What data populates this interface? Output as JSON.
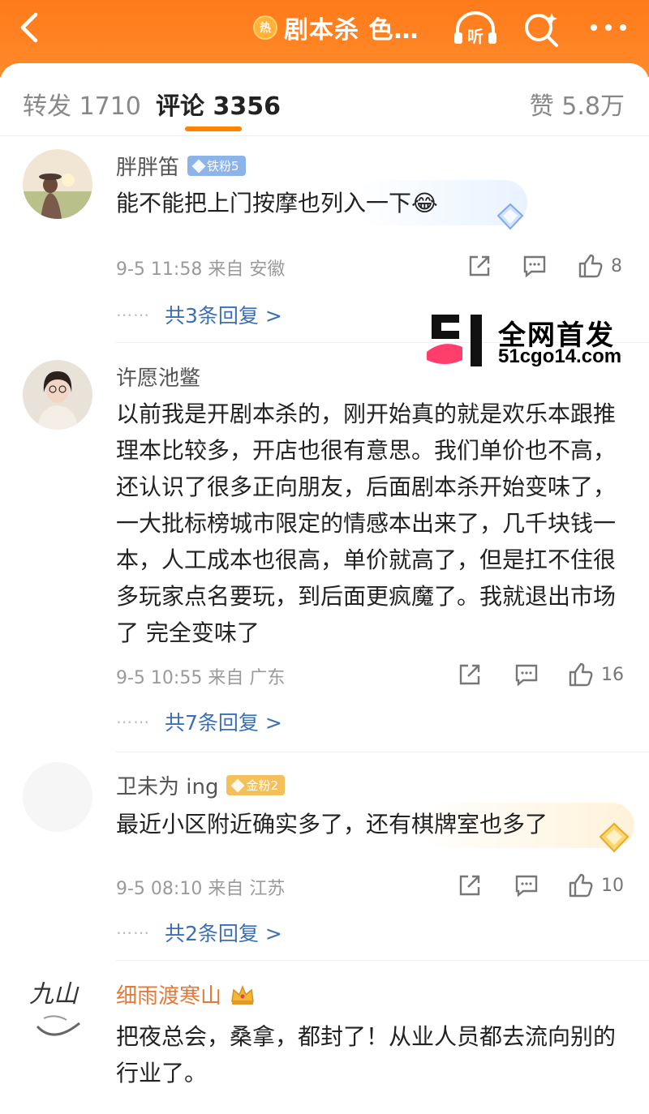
{
  "header": {
    "title": "剧本杀 色…",
    "hot_label": "热",
    "listen_label": "听"
  },
  "tabs": {
    "repost": "转发 1710",
    "comment": "评论 3356",
    "like": "赞 5.8万"
  },
  "watermark": {
    "line1": "全网首发",
    "line2": "51cgo14.com"
  },
  "comments": [
    {
      "username": "胖胖笛",
      "badge": "铁粉5",
      "text": "能不能把上门按摩也列入一下😂",
      "meta": "9-5 11:58 来自 安徽",
      "likes": "8",
      "replies": "共3条回复 >"
    },
    {
      "username": "许愿池鳖",
      "text": "以前我是开剧本杀的，刚开始真的就是欢乐本跟推理本比较多，开店也很有意思。我们单价也不高，还认识了很多正向朋友，后面剧本杀开始变味了，一大批标榜城市限定的情感本出来了，几千块钱一本，人工成本也很高，单价就高了，但是扛不住很多玩家点名要玩，到后面更疯魔了。我就退出市场了 完全变味了",
      "meta": "9-5 10:55 来自 广东",
      "likes": "16",
      "replies": "共7条回复 >"
    },
    {
      "username": "卫未为 ing",
      "badge": "金粉2",
      "text": "最近小区附近确实多了，还有棋牌室也多了",
      "meta": "9-5 08:10 来自 江苏",
      "likes": "10",
      "replies": "共2条回复 >"
    },
    {
      "username": "细雨渡寒山",
      "text": "把夜总会，桑拿，都封了！从业人员都去流向别的行业了。"
    }
  ],
  "colors": {
    "brand_orange": "#ff8200",
    "link_blue": "#3b6fb5",
    "meta_gray": "#9a9a9a"
  },
  "icons": [
    "back-arrow-icon",
    "hot-icon",
    "headphones-icon",
    "search-icon",
    "more-icon",
    "share-icon",
    "comment-icon",
    "like-icon",
    "crown-icon",
    "diamond-icon"
  ]
}
